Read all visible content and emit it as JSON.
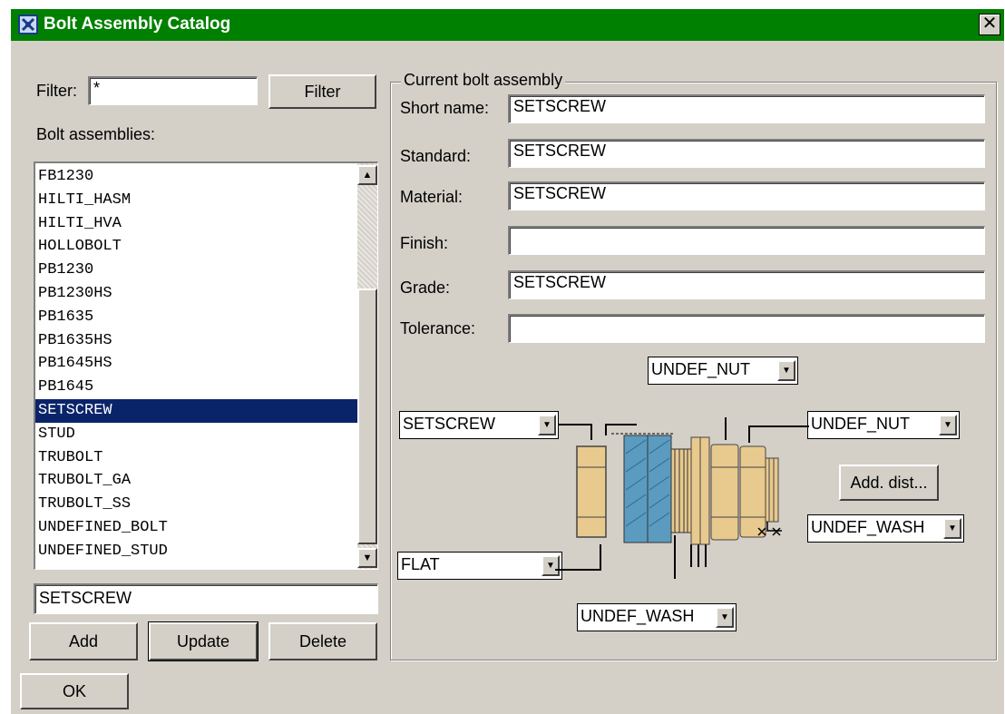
{
  "window": {
    "title": "Bolt Assembly Catalog",
    "close_glyph": "✕"
  },
  "filter": {
    "label": "Filter:",
    "value": "*",
    "button_label": "Filter"
  },
  "list": {
    "label": "Bolt assemblies:",
    "items": [
      "FB1230",
      "HILTI_HASM",
      "HILTI_HVA",
      "HOLLOBOLT",
      "PB1230",
      "PB1230HS",
      "PB1635",
      "PB1635HS",
      "PB1645HS",
      "PB1645",
      "SETSCREW",
      "STUD",
      "TRUBOLT",
      "TRUBOLT_GA",
      "TRUBOLT_SS",
      "UNDEFINED_BOLT",
      "UNDEFINED_STUD"
    ],
    "selected_index": 10
  },
  "name_input": {
    "value": "SETSCREW"
  },
  "buttons": {
    "add": "Add",
    "update": "Update",
    "delete": "Delete",
    "ok": "OK",
    "add_dist": "Add. dist..."
  },
  "current": {
    "legend": "Current bolt assembly",
    "fields": [
      {
        "label": "Short name:",
        "value": "SETSCREW"
      },
      {
        "label": "Standard:",
        "value": "SETSCREW"
      },
      {
        "label": "Material:",
        "value": "SETSCREW"
      },
      {
        "label": "Finish:",
        "value": ""
      },
      {
        "label": "Grade:",
        "value": "SETSCREW"
      },
      {
        "label": "Tolerance:",
        "value": ""
      }
    ]
  },
  "combos": {
    "top_nut": "UNDEF_NUT",
    "bolt": "SETSCREW",
    "right_nut": "UNDEF_NUT",
    "right_washer": "UNDEF_WASH",
    "washer_type": "FLAT",
    "bottom_washer": "UNDEF_WASH"
  },
  "icons": {
    "scroll_up": "▲",
    "scroll_down": "▼",
    "combo_arrow": "▼"
  },
  "colors": {
    "titlebar": "#008000",
    "selection": "#0a246a",
    "face": "#d4d0c8",
    "bolt_part": "#e8c98e",
    "plate": "#5b9bc0"
  }
}
